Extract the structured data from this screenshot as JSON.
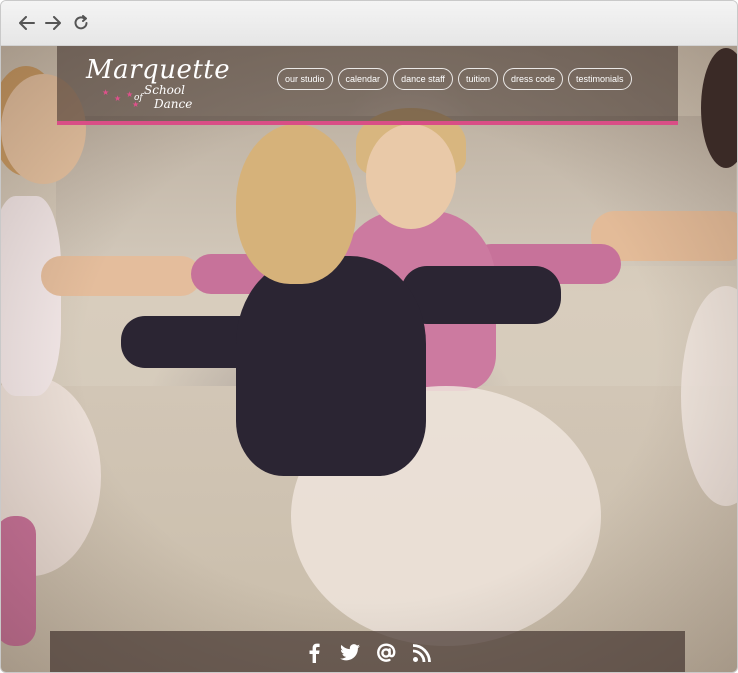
{
  "browser": {
    "back_icon": "arrow-left-icon",
    "forward_icon": "arrow-right-icon",
    "reload_icon": "reload-icon"
  },
  "logo": {
    "main": "Marquette",
    "line1": "School",
    "line2": "of",
    "line3": "Dance"
  },
  "nav": {
    "items": [
      {
        "label": "our studio"
      },
      {
        "label": "calendar"
      },
      {
        "label": "dance staff"
      },
      {
        "label": "tuition"
      },
      {
        "label": "dress code"
      },
      {
        "label": "testimonials"
      }
    ]
  },
  "footer": {
    "icons": [
      "facebook-icon",
      "twitter-icon",
      "email-icon",
      "rss-icon"
    ]
  },
  "colors": {
    "accent": "#d94e86",
    "header_bg": "rgba(60,45,40,0.55)",
    "footer_bg": "rgba(70,55,50,0.72)"
  }
}
